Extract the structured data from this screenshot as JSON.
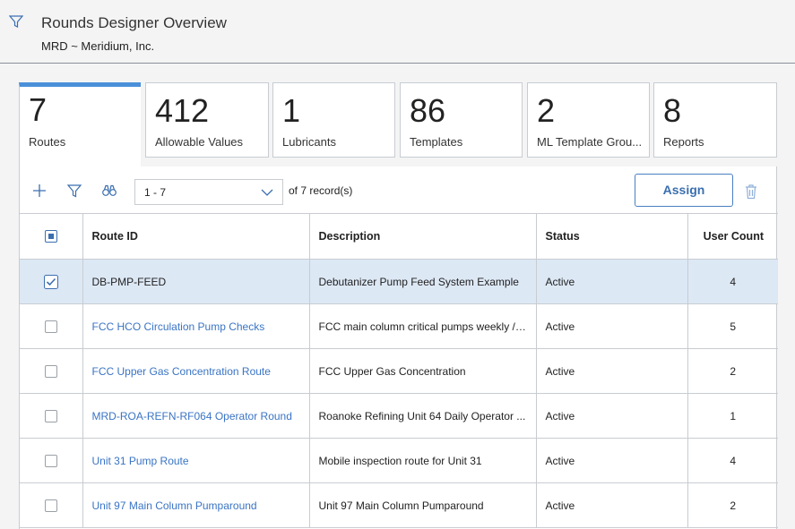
{
  "header": {
    "title": "Rounds Designer Overview",
    "subtitle": "MRD ~ Meridium, Inc."
  },
  "tabs": [
    {
      "count": "7",
      "label": "Routes",
      "active": true
    },
    {
      "count": "412",
      "label": "Allowable Values"
    },
    {
      "count": "1",
      "label": "Lubricants"
    },
    {
      "count": "86",
      "label": "Templates"
    },
    {
      "count": "2",
      "label": "ML Template Grou..."
    },
    {
      "count": "8",
      "label": "Reports"
    }
  ],
  "toolbar": {
    "range_value": "1 - 7",
    "of_text": "of 7  record(s)",
    "assign_label": "Assign"
  },
  "table": {
    "columns": [
      "Route ID",
      "Description",
      "Status",
      "User Count"
    ],
    "rows": [
      {
        "route_id": "DB-PMP-FEED",
        "description": "Debutanizer Pump Feed System Example",
        "status": "Active",
        "user_count": "4",
        "selected": true
      },
      {
        "route_id": "FCC HCO Circulation Pump Checks",
        "description": "FCC main column critical pumps weekly / ...",
        "status": "Active",
        "user_count": "5"
      },
      {
        "route_id": "FCC Upper Gas Concentration Route",
        "description": "FCC Upper Gas Concentration",
        "status": "Active",
        "user_count": "2"
      },
      {
        "route_id": "MRD-ROA-REFN-RF064 Operator Round",
        "description": "Roanoke Refining Unit 64 Daily Operator ...",
        "status": "Active",
        "user_count": "1"
      },
      {
        "route_id": "Unit 31 Pump Route",
        "description": "Mobile inspection route for Unit 31",
        "status": "Active",
        "user_count": "4"
      },
      {
        "route_id": "Unit 97 Main Column Pumparound",
        "description": "Unit 97 Main Column Pumparound",
        "status": "Active",
        "user_count": "2"
      }
    ]
  },
  "colors": {
    "accent": "#4a90d9",
    "link": "#3a74c4",
    "selected_row": "#dde8f5"
  }
}
